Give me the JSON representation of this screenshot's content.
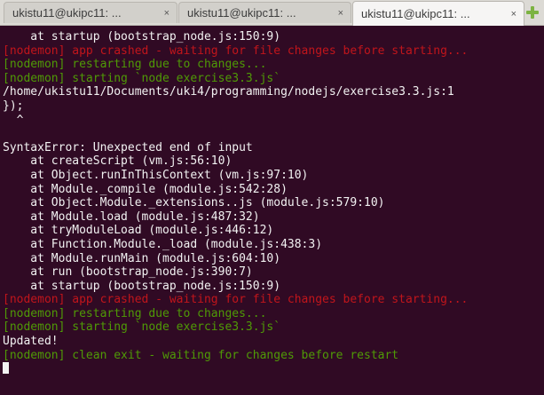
{
  "tabs": [
    {
      "title": "ukistu11@ukipc11: ...",
      "close": "×"
    },
    {
      "title": "ukistu11@ukipc11: ...",
      "close": "×"
    },
    {
      "title": "ukistu11@ukipc11: ...",
      "close": "×"
    }
  ],
  "active_tab": 2,
  "icons": {
    "new_tab": "plus-icon",
    "close": "close-icon"
  },
  "colors": {
    "background": "#300a24",
    "text": "#f2f2f2",
    "nodemon_error": "#c1151b",
    "nodemon_info": "#4f9a06",
    "add_button": "#7cb342"
  },
  "terminal": {
    "lines": [
      {
        "text": "    at startup (bootstrap_node.js:150:9)",
        "color": "white"
      },
      {
        "text": "[nodemon] app crashed - waiting for file changes before starting...",
        "color": "red"
      },
      {
        "text": "[nodemon] restarting due to changes...",
        "color": "green"
      },
      {
        "text": "[nodemon] starting `node exercise3.3.js`",
        "color": "green"
      },
      {
        "text": "/home/ukistu11/Documents/uki4/programming/nodejs/exercise3.3.js:1",
        "color": "white"
      },
      {
        "text": "});",
        "color": "white"
      },
      {
        "text": "  ^",
        "color": "white"
      },
      {
        "text": "",
        "color": "white"
      },
      {
        "text": "SyntaxError: Unexpected end of input",
        "color": "white"
      },
      {
        "text": "    at createScript (vm.js:56:10)",
        "color": "white"
      },
      {
        "text": "    at Object.runInThisContext (vm.js:97:10)",
        "color": "white"
      },
      {
        "text": "    at Module._compile (module.js:542:28)",
        "color": "white"
      },
      {
        "text": "    at Object.Module._extensions..js (module.js:579:10)",
        "color": "white"
      },
      {
        "text": "    at Module.load (module.js:487:32)",
        "color": "white"
      },
      {
        "text": "    at tryModuleLoad (module.js:446:12)",
        "color": "white"
      },
      {
        "text": "    at Function.Module._load (module.js:438:3)",
        "color": "white"
      },
      {
        "text": "    at Module.runMain (module.js:604:10)",
        "color": "white"
      },
      {
        "text": "    at run (bootstrap_node.js:390:7)",
        "color": "white"
      },
      {
        "text": "    at startup (bootstrap_node.js:150:9)",
        "color": "white"
      },
      {
        "text": "[nodemon] app crashed - waiting for file changes before starting...",
        "color": "red"
      },
      {
        "text": "[nodemon] restarting due to changes...",
        "color": "green"
      },
      {
        "text": "[nodemon] starting `node exercise3.3.js`",
        "color": "green"
      },
      {
        "text": "Updated!",
        "color": "white"
      },
      {
        "text": "[nodemon] clean exit - waiting for changes before restart",
        "color": "green"
      }
    ]
  }
}
